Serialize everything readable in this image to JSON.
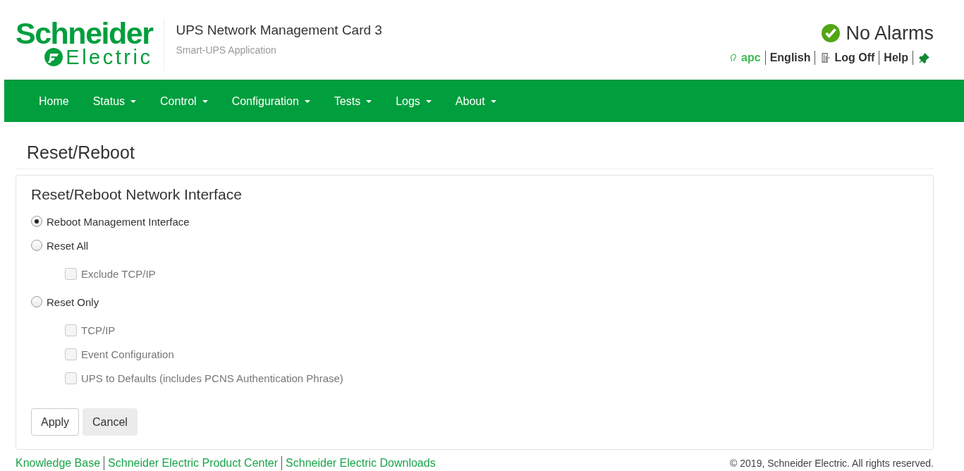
{
  "header": {
    "logo_top": "Schneider",
    "logo_bottom": "Electric",
    "product": "UPS Network Management Card 3",
    "application": "Smart-UPS Application",
    "alarm_status": "No Alarms",
    "user_links": [
      {
        "kind": "user",
        "label": "apc"
      },
      {
        "kind": "language",
        "label": "English"
      },
      {
        "kind": "logoff",
        "label": "Log Off"
      },
      {
        "kind": "help",
        "label": "Help"
      },
      {
        "kind": "pin"
      }
    ]
  },
  "nav": [
    {
      "label": "Home",
      "dropdown": false
    },
    {
      "label": "Status",
      "dropdown": true
    },
    {
      "label": "Control",
      "dropdown": true
    },
    {
      "label": "Configuration",
      "dropdown": true
    },
    {
      "label": "Tests",
      "dropdown": true
    },
    {
      "label": "Logs",
      "dropdown": true
    },
    {
      "label": "About",
      "dropdown": true
    }
  ],
  "page_title": "Reset/Reboot",
  "panel": {
    "title": "Reset/Reboot Network Interface",
    "options": [
      {
        "kind": "radio",
        "label": "Reboot Management Interface",
        "selected": true
      },
      {
        "kind": "radio",
        "label": "Reset All",
        "selected": false,
        "children": [
          {
            "kind": "checkbox",
            "label": "Exclude TCP/IP",
            "checked": false,
            "disabled": true
          }
        ]
      },
      {
        "kind": "radio",
        "label": "Reset Only",
        "selected": false,
        "children": [
          {
            "kind": "checkbox",
            "label": "TCP/IP",
            "checked": false,
            "disabled": true
          },
          {
            "kind": "checkbox",
            "label": "Event Configuration",
            "checked": false,
            "disabled": true
          },
          {
            "kind": "checkbox",
            "label": "UPS to Defaults (includes PCNS Authentication Phrase)",
            "checked": false,
            "disabled": true
          }
        ]
      }
    ],
    "buttons": [
      {
        "kind": "primary",
        "label": "Apply"
      },
      {
        "kind": "secondary",
        "label": "Cancel"
      }
    ]
  },
  "footer": {
    "links": [
      "Knowledge Base",
      "Schneider Electric Product Center",
      "Schneider Electric Downloads"
    ],
    "copyright": "© 2019, Schneider Electric. All rights reserved."
  }
}
